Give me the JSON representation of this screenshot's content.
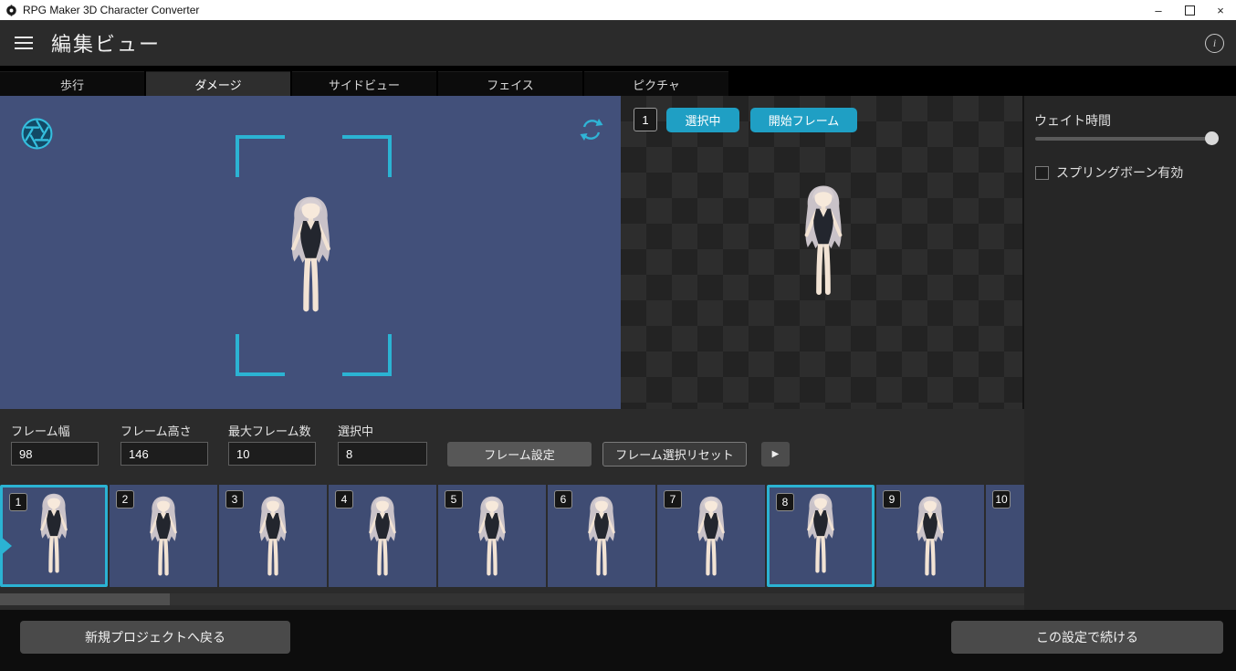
{
  "window": {
    "title": "RPG Maker 3D Character Converter",
    "minimize": "–",
    "close": "×"
  },
  "header": {
    "title": "編集ビュー",
    "info": "i"
  },
  "tabs": {
    "items": [
      {
        "label": "歩行",
        "active": false
      },
      {
        "label": "ダメージ",
        "active": true
      },
      {
        "label": "サイドビュー",
        "active": false
      },
      {
        "label": "フェイス",
        "active": false
      },
      {
        "label": "ピクチャ",
        "active": false
      }
    ]
  },
  "preview": {
    "frame_badge": "1",
    "selected_button": "選択中",
    "start_frame_button": "開始フレーム"
  },
  "sidebar": {
    "wait_time_label": "ウェイト時間",
    "spring_bone_label": "スプリングボーン有効",
    "spring_bone_checked": false
  },
  "settings": {
    "frame_width_label": "フレーム幅",
    "frame_width_value": "98",
    "frame_height_label": "フレーム高さ",
    "frame_height_value": "146",
    "max_frames_label": "最大フレーム数",
    "max_frames_value": "10",
    "selected_label": "選択中",
    "selected_value": "8",
    "frame_set_button": "フレーム設定",
    "frame_reset_button": "フレーム選択リセット",
    "play_button": "▶"
  },
  "frames": {
    "items": [
      {
        "number": "1",
        "selected": true
      },
      {
        "number": "2",
        "selected": false
      },
      {
        "number": "3",
        "selected": false
      },
      {
        "number": "4",
        "selected": false
      },
      {
        "number": "5",
        "selected": false
      },
      {
        "number": "6",
        "selected": false
      },
      {
        "number": "7",
        "selected": false
      },
      {
        "number": "8",
        "selected": true
      },
      {
        "number": "9",
        "selected": false
      },
      {
        "number": "10",
        "selected": false
      }
    ]
  },
  "footer": {
    "back_button": "新規プロジェクトへ戻る",
    "continue_button": "この設定で続ける"
  },
  "colors": {
    "accent": "#1f9fc4",
    "bracket": "#2bb3d3",
    "preview_bg": "#42507a"
  }
}
